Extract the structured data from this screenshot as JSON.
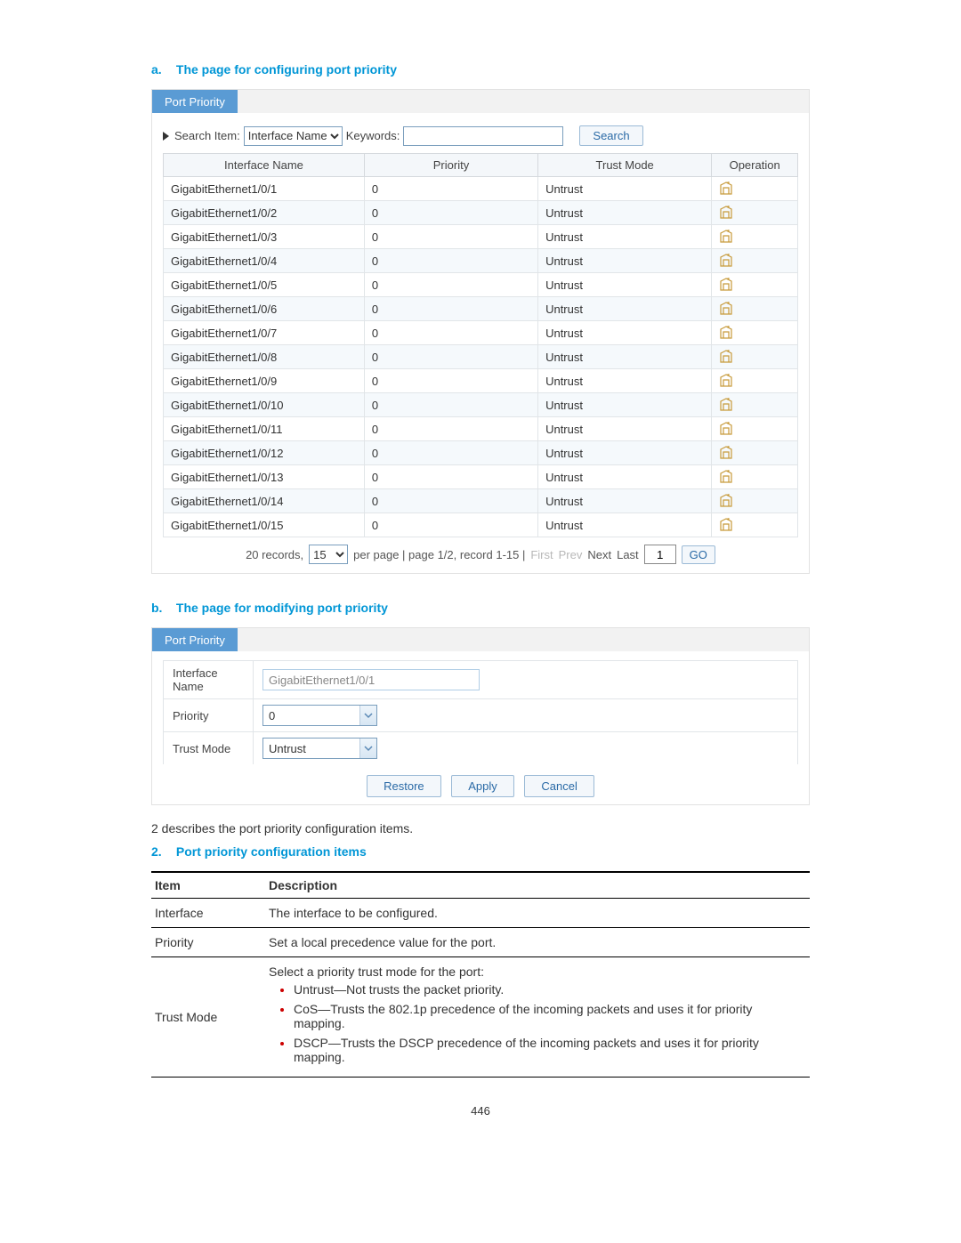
{
  "sectionA": {
    "lead": "a.",
    "title": "The page for configuring port priority"
  },
  "tabA": "Port Priority",
  "search": {
    "label": "Search Item:",
    "select": "Interface Name",
    "kwlabel": "Keywords:",
    "btn": "Search"
  },
  "columns": [
    "Interface Name",
    "Priority",
    "Trust Mode",
    "Operation"
  ],
  "rows": [
    {
      "name": "GigabitEthernet1/0/1",
      "prio": "0",
      "trust": "Untrust"
    },
    {
      "name": "GigabitEthernet1/0/2",
      "prio": "0",
      "trust": "Untrust"
    },
    {
      "name": "GigabitEthernet1/0/3",
      "prio": "0",
      "trust": "Untrust"
    },
    {
      "name": "GigabitEthernet1/0/4",
      "prio": "0",
      "trust": "Untrust"
    },
    {
      "name": "GigabitEthernet1/0/5",
      "prio": "0",
      "trust": "Untrust"
    },
    {
      "name": "GigabitEthernet1/0/6",
      "prio": "0",
      "trust": "Untrust"
    },
    {
      "name": "GigabitEthernet1/0/7",
      "prio": "0",
      "trust": "Untrust"
    },
    {
      "name": "GigabitEthernet1/0/8",
      "prio": "0",
      "trust": "Untrust"
    },
    {
      "name": "GigabitEthernet1/0/9",
      "prio": "0",
      "trust": "Untrust"
    },
    {
      "name": "GigabitEthernet1/0/10",
      "prio": "0",
      "trust": "Untrust"
    },
    {
      "name": "GigabitEthernet1/0/11",
      "prio": "0",
      "trust": "Untrust"
    },
    {
      "name": "GigabitEthernet1/0/12",
      "prio": "0",
      "trust": "Untrust"
    },
    {
      "name": "GigabitEthernet1/0/13",
      "prio": "0",
      "trust": "Untrust"
    },
    {
      "name": "GigabitEthernet1/0/14",
      "prio": "0",
      "trust": "Untrust"
    },
    {
      "name": "GigabitEthernet1/0/15",
      "prio": "0",
      "trust": "Untrust"
    }
  ],
  "pager": {
    "pre": "20 records,",
    "pagesize": "15",
    "mid": "per page | page 1/2, record 1-15 |",
    "first": "First",
    "prev": "Prev",
    "next": "Next",
    "last": "Last",
    "page": "1",
    "go": "GO"
  },
  "sectionB": {
    "lead": "b.",
    "title": "The page for modifying port priority"
  },
  "tabB": "Port Priority",
  "form": {
    "r1": "Interface Name",
    "v1": "GigabitEthernet1/0/1",
    "r2": "Priority",
    "v2": "0",
    "r3": "Trust Mode",
    "v3": "Untrust",
    "restore": "Restore",
    "apply": "Apply",
    "cancel": "Cancel"
  },
  "para": "2 describes the port priority configuration items.",
  "section2": {
    "lead": "2.",
    "title": "Port priority configuration items"
  },
  "docHead": {
    "c1": "Item",
    "c2": "Description"
  },
  "doc": {
    "i1": "Interface",
    "d1": "The interface to be configured.",
    "i2": "Priority",
    "d2": "Set a local precedence value for the port.",
    "i3": "Trust Mode",
    "d3intro": "Select a priority trust mode for the port:",
    "d3a": "Untrust—Not trusts the packet priority.",
    "d3b": "CoS—Trusts the 802.1p precedence of the incoming packets and uses it for priority mapping.",
    "d3c": "DSCP—Trusts the DSCP precedence of the incoming packets and uses it for priority mapping."
  },
  "pagenum": "446"
}
